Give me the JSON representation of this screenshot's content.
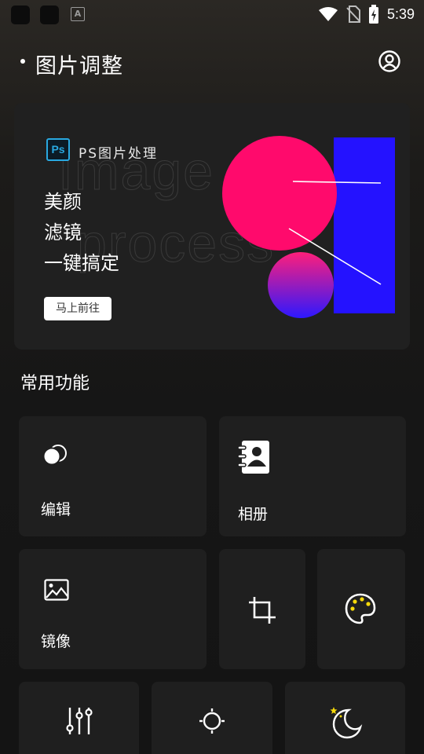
{
  "status_bar": {
    "time": "5:39",
    "app_badge_letter": "A",
    "icons": [
      "app-icon",
      "app-icon",
      "a-icon",
      "wifi-icon",
      "no-sim-icon",
      "battery-icon"
    ]
  },
  "header": {
    "title": "图片调整",
    "profile_icon": "user-circle-icon"
  },
  "banner": {
    "ps_logo_text": "Ps",
    "ps_label": "PS图片处理",
    "lines": [
      "美颜",
      "滤镜",
      "一键搞定"
    ],
    "button_label": "马上前往",
    "colors": {
      "pink": "#ff0a6c",
      "blue": "#2412ff",
      "gradient_top": "#ff1f7a",
      "gradient_bottom": "#2d18ff"
    }
  },
  "section": {
    "title": "常用功能"
  },
  "features": [
    {
      "label": "编辑",
      "icon": "overlap-circles-icon"
    },
    {
      "label": "相册",
      "icon": "contacts-book-icon"
    },
    {
      "label": "镜像",
      "icon": "image-icon"
    },
    {
      "label": "",
      "icon": "crop-icon"
    },
    {
      "label": "",
      "icon": "palette-icon"
    },
    {
      "label": "",
      "icon": "sliders-icon"
    },
    {
      "label": "",
      "icon": "brightness-icon"
    },
    {
      "label": "",
      "icon": "moon-star-icon"
    }
  ]
}
